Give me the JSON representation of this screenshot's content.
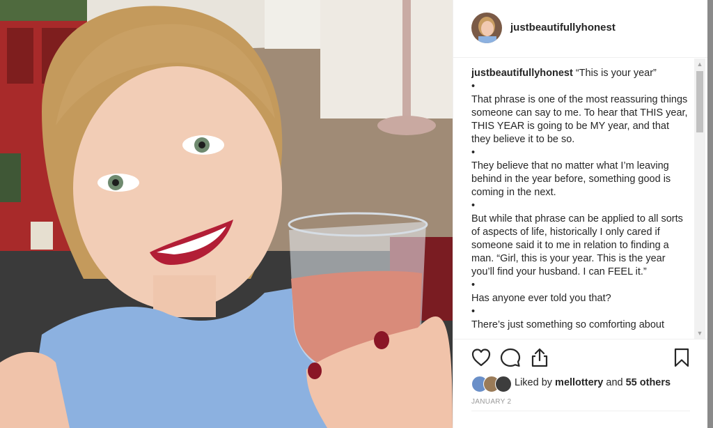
{
  "post": {
    "username": "justbeautifullyhonest",
    "caption_username": "justbeautifullyhonest",
    "caption_title": " “This is your year”",
    "caption_paragraphs": [
      "•",
      "That phrase is one of the most reassuring things someone can say to me. To hear that THIS year, THIS YEAR is going to be MY year, and that they believe it to be so.",
      "•",
      "They believe that no matter what I’m leaving behind in the year before, something good is coming in the next.",
      "•",
      "But while that phrase can be applied to all sorts of aspects of life, historically I only cared if someone said it to me in relation to finding a man. “Girl, this is your year. This is the year you’ll find your husband. I can FEEL it.”",
      "•",
      "Has anyone ever told you that?",
      "•",
      "There’s just something so comforting about"
    ],
    "likes_prefix": "Liked by ",
    "likes_user": "mellottery",
    "likes_mid": " and ",
    "likes_count": "55 others",
    "date": "JANUARY 2"
  },
  "icons": {
    "like": "heart-icon",
    "comment": "comment-icon",
    "share": "share-icon",
    "save": "bookmark-icon"
  },
  "colors": {
    "text": "#262626",
    "muted": "#999999",
    "border": "#efefef"
  }
}
